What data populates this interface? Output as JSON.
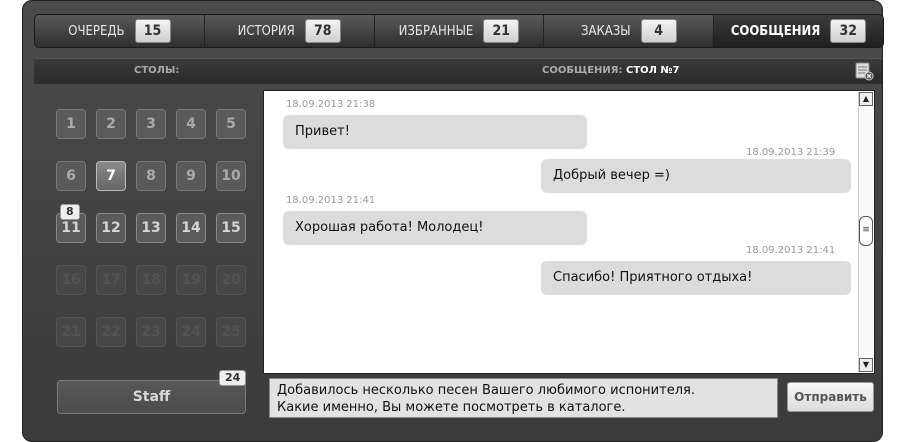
{
  "tabs": [
    {
      "label": "ОЧЕРЕДЬ",
      "count": "15"
    },
    {
      "label": "ИСТОРИЯ",
      "count": "78"
    },
    {
      "label": "ИЗБРАННЫЕ",
      "count": "21"
    },
    {
      "label": "ЗАКАЗЫ",
      "count": "4"
    },
    {
      "label": "СООБЩЕНИЯ",
      "count": "32"
    }
  ],
  "header": {
    "tables_title": "СТОЛЫ:",
    "messages_prefix": "СООБЩЕНИЯ:",
    "messages_table": "СТОЛ №7"
  },
  "tables": [
    "1",
    "2",
    "3",
    "4",
    "5",
    "6",
    "7",
    "8",
    "9",
    "10",
    "11",
    "12",
    "13",
    "14",
    "15",
    "16",
    "17",
    "18",
    "19",
    "20",
    "21",
    "22",
    "23",
    "24",
    "25"
  ],
  "selected_table": "7",
  "table_badge": "8",
  "staff": {
    "label": "Staff",
    "badge": "24"
  },
  "messages": [
    {
      "timestamp": "18.09.2013  21:38",
      "text": "Привет!"
    },
    {
      "timestamp": "18.09.2013  21:39",
      "text": "Добрый вечер =)"
    },
    {
      "timestamp": "18.09.2013  21:41",
      "text": "Хорошая работа! Молодец!"
    },
    {
      "timestamp": "18.09.2013  21:41",
      "text": "Спасибо! Приятного отдыха!"
    }
  ],
  "input": {
    "line1": "Добавилось несколько песен Вашего любимого испонителя.",
    "line2": "Какие именно, Вы можете посмотреть в каталоге."
  },
  "send_label": "Отправить"
}
